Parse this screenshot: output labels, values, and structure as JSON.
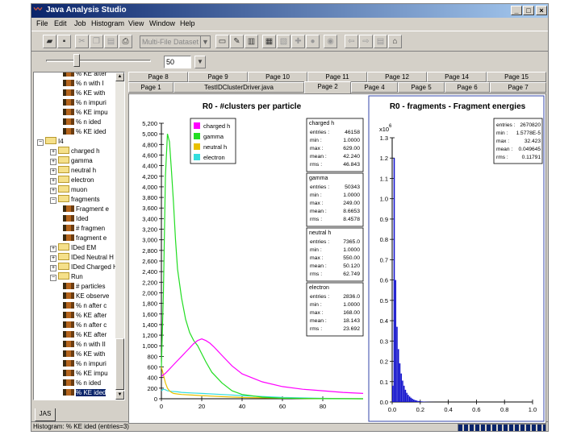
{
  "window": {
    "title": "Java Analysis Studio",
    "min_label": "_",
    "max_label": "□",
    "close_label": "×"
  },
  "menu": [
    "File",
    "Edit",
    "Job",
    "Histogram",
    "View",
    "Window",
    "Help"
  ],
  "toolbar": {
    "dataset_combo": "Multi-File Dataset"
  },
  "slider": {
    "value": "50"
  },
  "tree": [
    {
      "label": "% KE after",
      "indent": 4,
      "icon": "hist"
    },
    {
      "label": "% n with I",
      "indent": 4,
      "icon": "hist"
    },
    {
      "label": "% KE with",
      "indent": 4,
      "icon": "hist"
    },
    {
      "label": "% n impuri",
      "indent": 4,
      "icon": "hist"
    },
    {
      "label": "% KE impu",
      "indent": 4,
      "icon": "hist"
    },
    {
      "label": "% n ided",
      "indent": 4,
      "icon": "hist"
    },
    {
      "label": "% KE ided",
      "indent": 4,
      "icon": "hist"
    },
    {
      "label": "I4",
      "indent": 0,
      "icon": "folder",
      "expander": "−"
    },
    {
      "label": "charged h",
      "indent": 2,
      "icon": "folder",
      "expander": "+"
    },
    {
      "label": "gamma",
      "indent": 2,
      "icon": "folder",
      "expander": "+"
    },
    {
      "label": "neutral h",
      "indent": 2,
      "icon": "folder",
      "expander": "+"
    },
    {
      "label": "electron",
      "indent": 2,
      "icon": "folder",
      "expander": "+"
    },
    {
      "label": "muon",
      "indent": 2,
      "icon": "folder",
      "expander": "+"
    },
    {
      "label": "fragments",
      "indent": 2,
      "icon": "folder",
      "expander": "−"
    },
    {
      "label": "Fragment e",
      "indent": 4,
      "icon": "hist"
    },
    {
      "label": "Ided",
      "indent": 4,
      "icon": "hist"
    },
    {
      "label": "# fragmen",
      "indent": 4,
      "icon": "hist"
    },
    {
      "label": "fragment e",
      "indent": 4,
      "icon": "hist"
    },
    {
      "label": "IDed EM",
      "indent": 2,
      "icon": "folder",
      "expander": "+"
    },
    {
      "label": "IDed Neutral H",
      "indent": 2,
      "icon": "folder",
      "expander": "+"
    },
    {
      "label": "IDed Charged H",
      "indent": 2,
      "icon": "folder",
      "expander": "+"
    },
    {
      "label": "Run",
      "indent": 2,
      "icon": "folder",
      "expander": "−"
    },
    {
      "label": "# particles",
      "indent": 4,
      "icon": "hist"
    },
    {
      "label": "KE observe",
      "indent": 4,
      "icon": "hist"
    },
    {
      "label": "% n after c",
      "indent": 4,
      "icon": "hist"
    },
    {
      "label": "% KE after",
      "indent": 4,
      "icon": "hist"
    },
    {
      "label": "% n after c",
      "indent": 4,
      "icon": "hist"
    },
    {
      "label": "% KE after",
      "indent": 4,
      "icon": "hist"
    },
    {
      "label": "% n with II",
      "indent": 4,
      "icon": "hist"
    },
    {
      "label": "% KE with",
      "indent": 4,
      "icon": "hist"
    },
    {
      "label": "% n impuri",
      "indent": 4,
      "icon": "hist"
    },
    {
      "label": "% KE impu",
      "indent": 4,
      "icon": "hist"
    },
    {
      "label": "% n ided",
      "indent": 4,
      "icon": "hist"
    },
    {
      "label": "% KE ided",
      "indent": 4,
      "icon": "hist",
      "selected": true
    }
  ],
  "bottom_tab": "JAS",
  "status": "Histogram: % KE ided (entries=3)",
  "tabs_back": [
    "Page 8",
    "Page 9",
    "Page 10",
    "Page 11",
    "Page 12",
    "Page 14",
    "Page 15"
  ],
  "tabs_front": [
    "Page 1",
    "TestIDClusterDriver.java",
    "Page 2",
    "Page 4",
    "Page 5",
    "Page 6",
    "Page 7"
  ],
  "active_tab": "Page 2",
  "colors": {
    "charged_h": "#ff00ff",
    "gamma": "#22dd22",
    "neutral_h": "#e8c000",
    "electron": "#33dddd",
    "fragment": "#1010cc"
  },
  "chart_data": [
    {
      "type": "line",
      "title": "R0 - #clusters per particle",
      "xlim": [
        0,
        100
      ],
      "ylim": [
        0,
        5200
      ],
      "x_ticks": [
        0,
        20,
        40,
        60,
        80
      ],
      "y_ticks": [
        "0",
        "200",
        "400",
        "600",
        "800",
        "1,000",
        "1,200",
        "1,400",
        "1,600",
        "1,800",
        "2,000",
        "2,200",
        "2,400",
        "2,600",
        "2,800",
        "3,000",
        "3,200",
        "3,400",
        "3,600",
        "3,800",
        "4,000",
        "4,200",
        "4,400",
        "4,600",
        "4,800",
        "5,000",
        "5,200"
      ],
      "legend": [
        "charged h",
        "gamma",
        "neutral h",
        "electron"
      ],
      "series": [
        {
          "name": "charged h",
          "color": "#ff00ff",
          "x": [
            0,
            2,
            4,
            6,
            8,
            10,
            12,
            14,
            16,
            18,
            20,
            22,
            24,
            26,
            28,
            30,
            35,
            40,
            50,
            60,
            70,
            80,
            90,
            100
          ],
          "y": [
            420,
            480,
            560,
            640,
            720,
            800,
            880,
            960,
            1040,
            1100,
            1130,
            1100,
            1050,
            980,
            900,
            820,
            620,
            470,
            320,
            230,
            180,
            150,
            120,
            100
          ]
        },
        {
          "name": "gamma",
          "color": "#22dd22",
          "x": [
            0,
            1,
            2,
            3,
            4,
            5,
            6,
            7,
            8,
            10,
            12,
            14,
            16,
            18,
            20,
            22,
            25,
            30,
            35,
            40,
            50,
            60,
            80,
            100
          ],
          "y": [
            600,
            2000,
            4200,
            5000,
            4850,
            4300,
            3700,
            3000,
            2450,
            1900,
            1500,
            1250,
            1100,
            1000,
            850,
            700,
            500,
            300,
            150,
            80,
            30,
            10,
            2,
            0
          ]
        },
        {
          "name": "neutral h",
          "color": "#e8c000",
          "x": [
            0,
            1,
            2,
            3,
            4,
            5,
            6,
            8,
            10,
            15,
            20,
            30,
            40,
            60,
            80,
            100
          ],
          "y": [
            600,
            450,
            300,
            200,
            150,
            120,
            100,
            90,
            80,
            70,
            60,
            40,
            25,
            10,
            3,
            0
          ]
        },
        {
          "name": "electron",
          "color": "#33dddd",
          "x": [
            0,
            1,
            2,
            3,
            5,
            8,
            10,
            15,
            20,
            30,
            40,
            60,
            80,
            100
          ],
          "y": [
            150,
            180,
            170,
            150,
            140,
            130,
            120,
            110,
            100,
            80,
            60,
            25,
            8,
            0
          ]
        }
      ],
      "stats": [
        {
          "name": "charged h",
          "rows": [
            [
              "entries",
              "46158"
            ],
            [
              "min",
              "1.0000"
            ],
            [
              "max",
              "629.00"
            ],
            [
              "mean",
              "42.240"
            ],
            [
              "rms",
              "46.843"
            ]
          ]
        },
        {
          "name": "gamma",
          "rows": [
            [
              "entries",
              "50343"
            ],
            [
              "min",
              "1.0000"
            ],
            [
              "max",
              "249.00"
            ],
            [
              "mean",
              "8.6653"
            ],
            [
              "rms",
              "8.4578"
            ]
          ]
        },
        {
          "name": "neutral h",
          "rows": [
            [
              "entries",
              "7365.0"
            ],
            [
              "min",
              "1.0000"
            ],
            [
              "max",
              "550.00"
            ],
            [
              "mean",
              "50.120"
            ],
            [
              "rms",
              "62.749"
            ]
          ]
        },
        {
          "name": "electron",
          "rows": [
            [
              "entries",
              "2836.0"
            ],
            [
              "min",
              "1.0000"
            ],
            [
              "max",
              "168.00"
            ],
            [
              "mean",
              "18.143"
            ],
            [
              "rms",
              "23.692"
            ]
          ]
        }
      ]
    },
    {
      "type": "bar",
      "title": "R0 - fragments - Fragment energies",
      "xlim": [
        0,
        1.0
      ],
      "ylim": [
        0,
        1.3
      ],
      "y_scale_label": "x10",
      "y_scale_exp": "6",
      "x_ticks": [
        "0.0",
        "0.2",
        "0.4",
        "0.6",
        "0.8",
        "1.0"
      ],
      "y_ticks": [
        "0.0",
        "0.1",
        "0.2",
        "0.3",
        "0.4",
        "0.5",
        "0.6",
        "0.7",
        "0.8",
        "0.9",
        "1.0",
        "1.1",
        "1.2",
        "1.3"
      ],
      "bin_width": 0.01,
      "values": [
        0.08,
        1.2,
        0.6,
        0.37,
        0.26,
        0.19,
        0.14,
        0.105,
        0.08,
        0.06,
        0.045,
        0.035,
        0.027,
        0.021,
        0.016,
        0.012,
        0.009,
        0.007,
        0.005,
        0.004,
        0.003,
        0.0025,
        0.002,
        0.0015,
        0.001,
        0.0008,
        0.0006,
        0.0004,
        0.0003,
        0.0002,
        0.0001,
        0.0001
      ],
      "stats": [
        [
          "entries",
          "2670820"
        ],
        [
          "min",
          "1.5778E-5"
        ],
        [
          "max",
          "32.423"
        ],
        [
          "mean",
          "0.049645"
        ],
        [
          "rms",
          "0.11791"
        ]
      ]
    }
  ]
}
